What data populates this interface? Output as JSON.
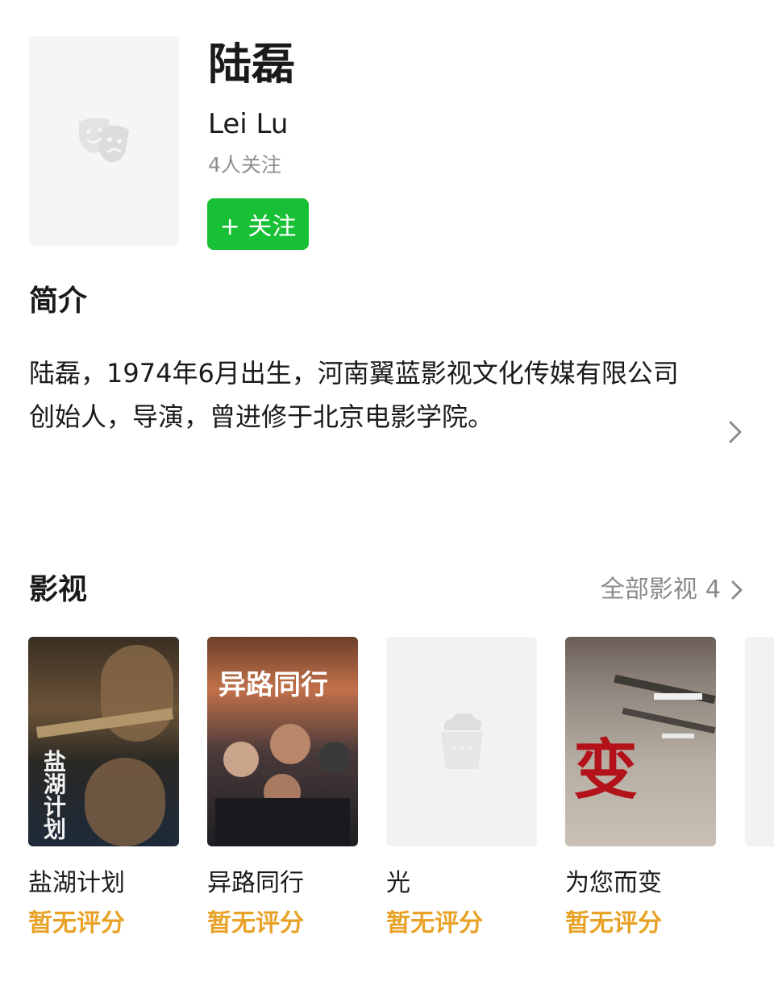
{
  "person": {
    "name": "陆磊",
    "english_name": "Lei Lu",
    "followers": "4人关注",
    "follow_button": "+ 关注",
    "avatar_icon": "theater-masks-icon"
  },
  "intro": {
    "title": "简介",
    "text": "陆磊，1974年6月出生，河南翼蓝影视文化传媒有限公司创始人，导演，曾进修于北京电影学院。"
  },
  "films": {
    "title": "影视",
    "all_label": "全部影视",
    "count": "4",
    "items": [
      {
        "title": "盐湖计划",
        "rating": "暂无评分",
        "poster_text": "盐湖计划"
      },
      {
        "title": "异路同行",
        "rating": "暂无评分",
        "poster_text": "异路同行"
      },
      {
        "title": "光",
        "rating": "暂无评分",
        "poster_icon": "popcorn-icon"
      },
      {
        "title": "为您而变",
        "rating": "暂无评分",
        "poster_text": "变"
      }
    ]
  },
  "colors": {
    "accent_green": "#18c035",
    "rating_orange": "#e8a227",
    "muted_text": "#8f8f8f"
  }
}
